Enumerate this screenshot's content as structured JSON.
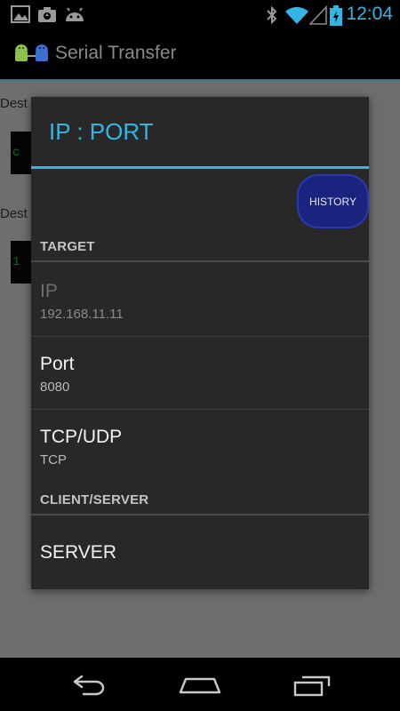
{
  "status_bar": {
    "time": "12:04",
    "left_icons": [
      "gallery-icon",
      "camera-upload-icon",
      "android-icon"
    ],
    "right_icons": [
      "bluetooth-icon",
      "wifi-icon",
      "cell-signal-icon",
      "battery-charging-icon"
    ],
    "accent_color": "#33b5e5"
  },
  "action_bar": {
    "app_icon": "android-transfer-icon",
    "title": "Serial Transfer"
  },
  "background_screen": {
    "labels": [
      "Dest",
      "Dest"
    ],
    "fields": [
      "c",
      "1"
    ]
  },
  "dialog": {
    "title": "IP : PORT",
    "title_color": "#33b5e5",
    "history_button": {
      "label": "HISTORY",
      "color": "#1a237e"
    },
    "categories": [
      {
        "title": "TARGET",
        "items": [
          {
            "title": "IP",
            "summary": "192.168.11.11",
            "enabled": false
          },
          {
            "title": "Port",
            "summary": "8080",
            "enabled": true
          },
          {
            "title": "TCP/UDP",
            "summary": "TCP",
            "enabled": true
          }
        ]
      },
      {
        "title": "CLIENT/SERVER",
        "items": [
          {
            "title": "SERVER",
            "summary": "",
            "enabled": true
          }
        ]
      }
    ]
  },
  "nav_bar": {
    "buttons": [
      "back-icon",
      "home-icon",
      "recent-apps-icon"
    ]
  }
}
